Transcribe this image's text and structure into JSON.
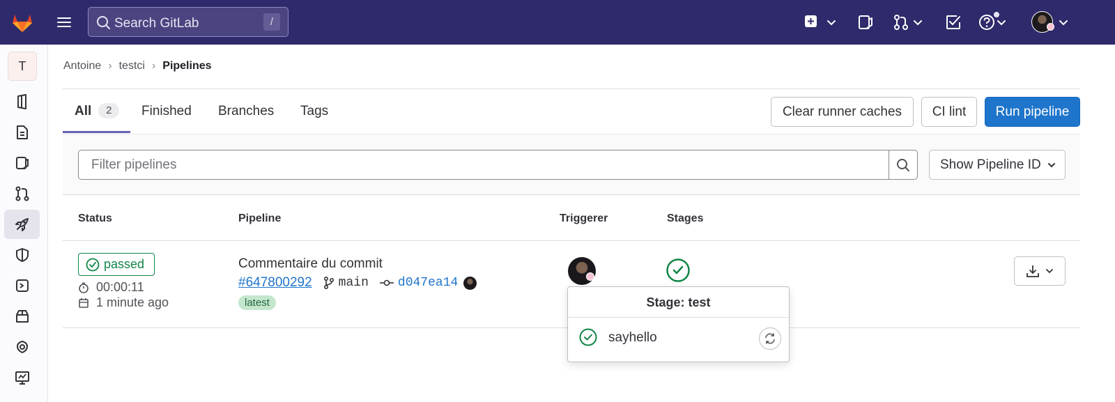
{
  "topbar": {
    "search_placeholder": "Search GitLab",
    "search_shortcut": "/",
    "brand_color": "#2f2a6b"
  },
  "sidebar": {
    "project_initial": "T",
    "items": [
      {
        "icon": "project-overview-icon"
      },
      {
        "icon": "repository-icon"
      },
      {
        "icon": "issues-icon"
      },
      {
        "icon": "merge-requests-icon"
      },
      {
        "icon": "ci-cd-rocket-icon",
        "active": true
      },
      {
        "icon": "security-shield-icon"
      },
      {
        "icon": "deployments-icon"
      },
      {
        "icon": "packages-icon"
      },
      {
        "icon": "infrastructure-icon"
      },
      {
        "icon": "monitor-icon"
      }
    ]
  },
  "breadcrumb": {
    "items": [
      "Antoine",
      "testci"
    ],
    "current": "Pipelines"
  },
  "tabs": {
    "all": "All",
    "all_count": "2",
    "finished": "Finished",
    "branches": "Branches",
    "tags": "Tags"
  },
  "actions": {
    "clear_caches": "Clear runner caches",
    "ci_lint": "CI lint",
    "run_pipeline": "Run pipeline"
  },
  "filter": {
    "placeholder": "Filter pipelines",
    "show_id": "Show Pipeline ID"
  },
  "table": {
    "headers": {
      "status": "Status",
      "pipeline": "Pipeline",
      "triggerer": "Triggerer",
      "stages": "Stages"
    },
    "rows": [
      {
        "status": "passed",
        "duration": "00:00:11",
        "finished": "1 minute ago",
        "commit_title": "Commentaire du commit",
        "pipeline_id": "#647800292",
        "branch": "main",
        "sha": "d047ea14",
        "badge": "latest"
      }
    ]
  },
  "stage_dropdown": {
    "title": "Stage: test",
    "jobs": [
      {
        "name": "sayhello",
        "status": "success"
      }
    ]
  },
  "colors": {
    "success": "#108548",
    "link": "#1f75cb",
    "primary": "#1f75cb"
  }
}
